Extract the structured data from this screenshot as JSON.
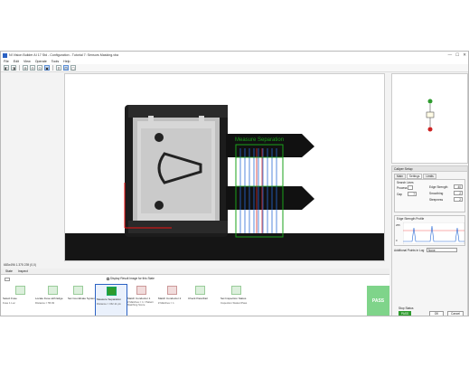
{
  "window": {
    "title": "NI Vision Builder AI 17 Std - Configuration - Tutorial 7: Sensors Masking.vba",
    "min": "—",
    "max": "☐",
    "close": "✕"
  },
  "menu": [
    "File",
    "Edit",
    "View",
    "Operate",
    "Tools",
    "Help"
  ],
  "toolbar": {
    "buttons": [
      "◧",
      "◨",
      "⊕",
      "⊖",
      "⊙",
      "▣",
      "⚲",
      "⊡",
      "▢"
    ]
  },
  "overlay": {
    "label": "Measure Separation"
  },
  "status": {
    "text": "683x496 1.375 239 (0,0)"
  },
  "tabs": [
    "State",
    "Inspect"
  ],
  "steps_bar": {
    "toggle_label": "Display Result Image for this State",
    "steps": [
      {
        "name": "Select Fuse",
        "sub": "Fuse 1 Loc"
      },
      {
        "name": "Locate Fuse with Edge",
        "sub": "Distance = 55.93"
      },
      {
        "name": "Set Coordinate System",
        "sub": ""
      },
      {
        "name": "Measure Separation",
        "sub": "Distance = 152.11 pix"
      },
      {
        "name": "Match Conductor 1",
        "sub": "# Matches = 1 / Pattern Matching Score"
      },
      {
        "name": "Match Conductor 2",
        "sub": "# Matches = 1"
      },
      {
        "name": "Check Pass/Fail",
        "sub": ""
      },
      {
        "name": "Set Inspection Status",
        "sub": "Inspection Status=Pass"
      }
    ],
    "result": "PASS"
  },
  "state_diagram": {
    "start": "",
    "node": "Inspect",
    "end": ""
  },
  "properties": {
    "title": "Caliper Setup",
    "tabs": [
      "Main",
      "Settings",
      "Limits"
    ],
    "active_tab": "Settings",
    "search_label": "Search Lines",
    "fields": [
      {
        "label": "Process",
        "value": ""
      },
      {
        "label": "Edge Strength",
        "value": "40"
      },
      {
        "label": "Gap",
        "value": "7"
      },
      {
        "label": "Smoothing",
        "value": "2"
      },
      {
        "label": "Steepness",
        "value": "2"
      }
    ],
    "profile_title": "Edge Strength Profile",
    "y_max": "255",
    "y_min": "0",
    "overlay_label": "Additional Points in Log",
    "overlay_value": "None",
    "run_button": "Stop Status",
    "pass_label": "PASS",
    "ok_button": "OK",
    "cancel_button": "Cancel"
  }
}
